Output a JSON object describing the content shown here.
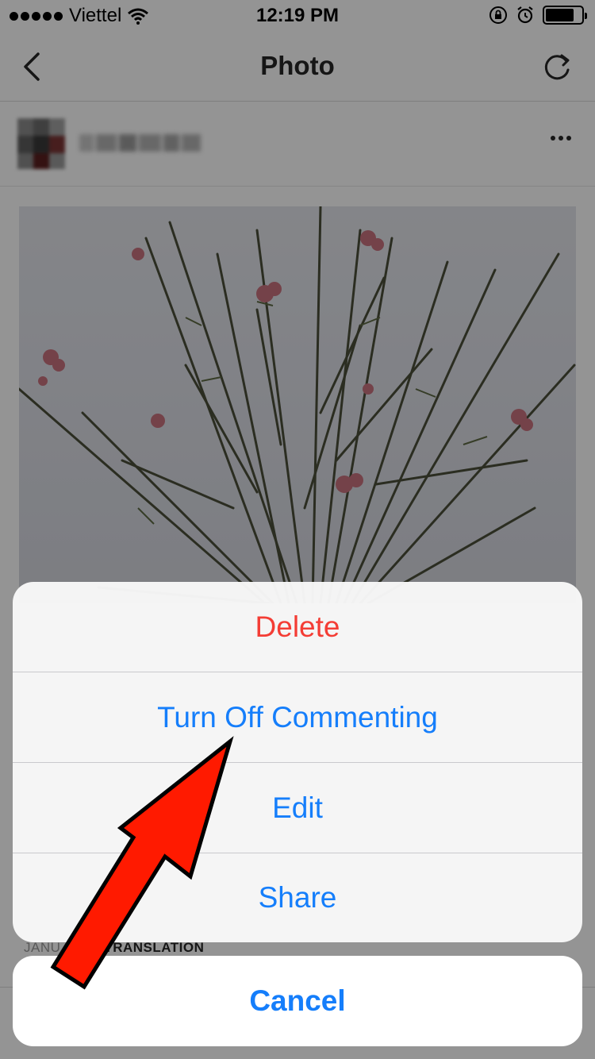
{
  "status_bar": {
    "carrier": "Viettel",
    "time": "12:19 PM",
    "icons": [
      "signal-dots-icon",
      "wifi-icon",
      "orientation-lock-icon",
      "alarm-icon",
      "battery-icon"
    ],
    "battery_level": 0.8
  },
  "nav": {
    "title": "Photo",
    "back_icon": "chevron-left-icon",
    "refresh_icon": "refresh-icon"
  },
  "post": {
    "more_icon": "more-horizontal-icon"
  },
  "caption": {
    "date": "JANU",
    "translate": "SEE TRANSLATION"
  },
  "action_sheet": {
    "items": [
      {
        "label": "Delete",
        "style": "destructive"
      },
      {
        "label": "Turn Off Commenting",
        "style": "default"
      },
      {
        "label": "Edit",
        "style": "default"
      },
      {
        "label": "Share",
        "style": "default"
      }
    ],
    "cancel": "Cancel"
  },
  "colors": {
    "ios_blue": "#157efb",
    "destructive_red": "#f43d35",
    "annotation_arrow": "#ff1a00"
  }
}
